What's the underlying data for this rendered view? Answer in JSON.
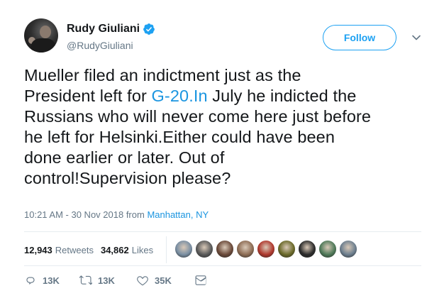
{
  "user": {
    "display_name": "Rudy Giuliani",
    "handle": "@RudyGiuliani",
    "verified": true
  },
  "follow_button": {
    "label": "Follow"
  },
  "tweet": {
    "lines": [
      {
        "parts": [
          {
            "text": "Mueller filed an indictment just as the"
          }
        ]
      },
      {
        "parts": [
          {
            "text": "President left for "
          },
          {
            "text": "G-20.In",
            "link": true
          },
          {
            "text": " July he indicted the"
          }
        ]
      },
      {
        "parts": [
          {
            "text": "Russians who will never come here just before"
          }
        ]
      },
      {
        "parts": [
          {
            "text": "he left for Helsinki.Either could have been"
          }
        ]
      },
      {
        "parts": [
          {
            "text": "done earlier or later. Out of"
          }
        ]
      },
      {
        "parts": [
          {
            "text": "control!Supervision please?"
          }
        ]
      }
    ]
  },
  "meta": {
    "timestamp": "10:21 AM - 30 Nov 2018 from ",
    "location": "Manhattan, NY"
  },
  "stats": {
    "retweets_count": "12,943",
    "retweets_label": "Retweets",
    "likes_count": "34,862",
    "likes_label": "Likes"
  },
  "likers": [
    {
      "name": "liker-avatar-1",
      "color": "#7a8fa3"
    },
    {
      "name": "liker-avatar-2",
      "color": "#5a5a5a"
    },
    {
      "name": "liker-avatar-3",
      "color": "#6b4a3a"
    },
    {
      "name": "liker-avatar-4",
      "color": "#8e6d55"
    },
    {
      "name": "liker-avatar-5",
      "color": "#b0392e"
    },
    {
      "name": "liker-avatar-6",
      "color": "#6b6a2a"
    },
    {
      "name": "liker-avatar-7",
      "color": "#2b2b2b"
    },
    {
      "name": "liker-avatar-8",
      "color": "#4f7a59"
    },
    {
      "name": "liker-avatar-9",
      "color": "#6d7f8f"
    }
  ],
  "actions": {
    "reply_count": "13K",
    "retweet_count": "13K",
    "like_count": "35K"
  },
  "colors": {
    "accent": "#1da1f2",
    "link": "#1b95e0",
    "secondary_text": "#657786"
  }
}
